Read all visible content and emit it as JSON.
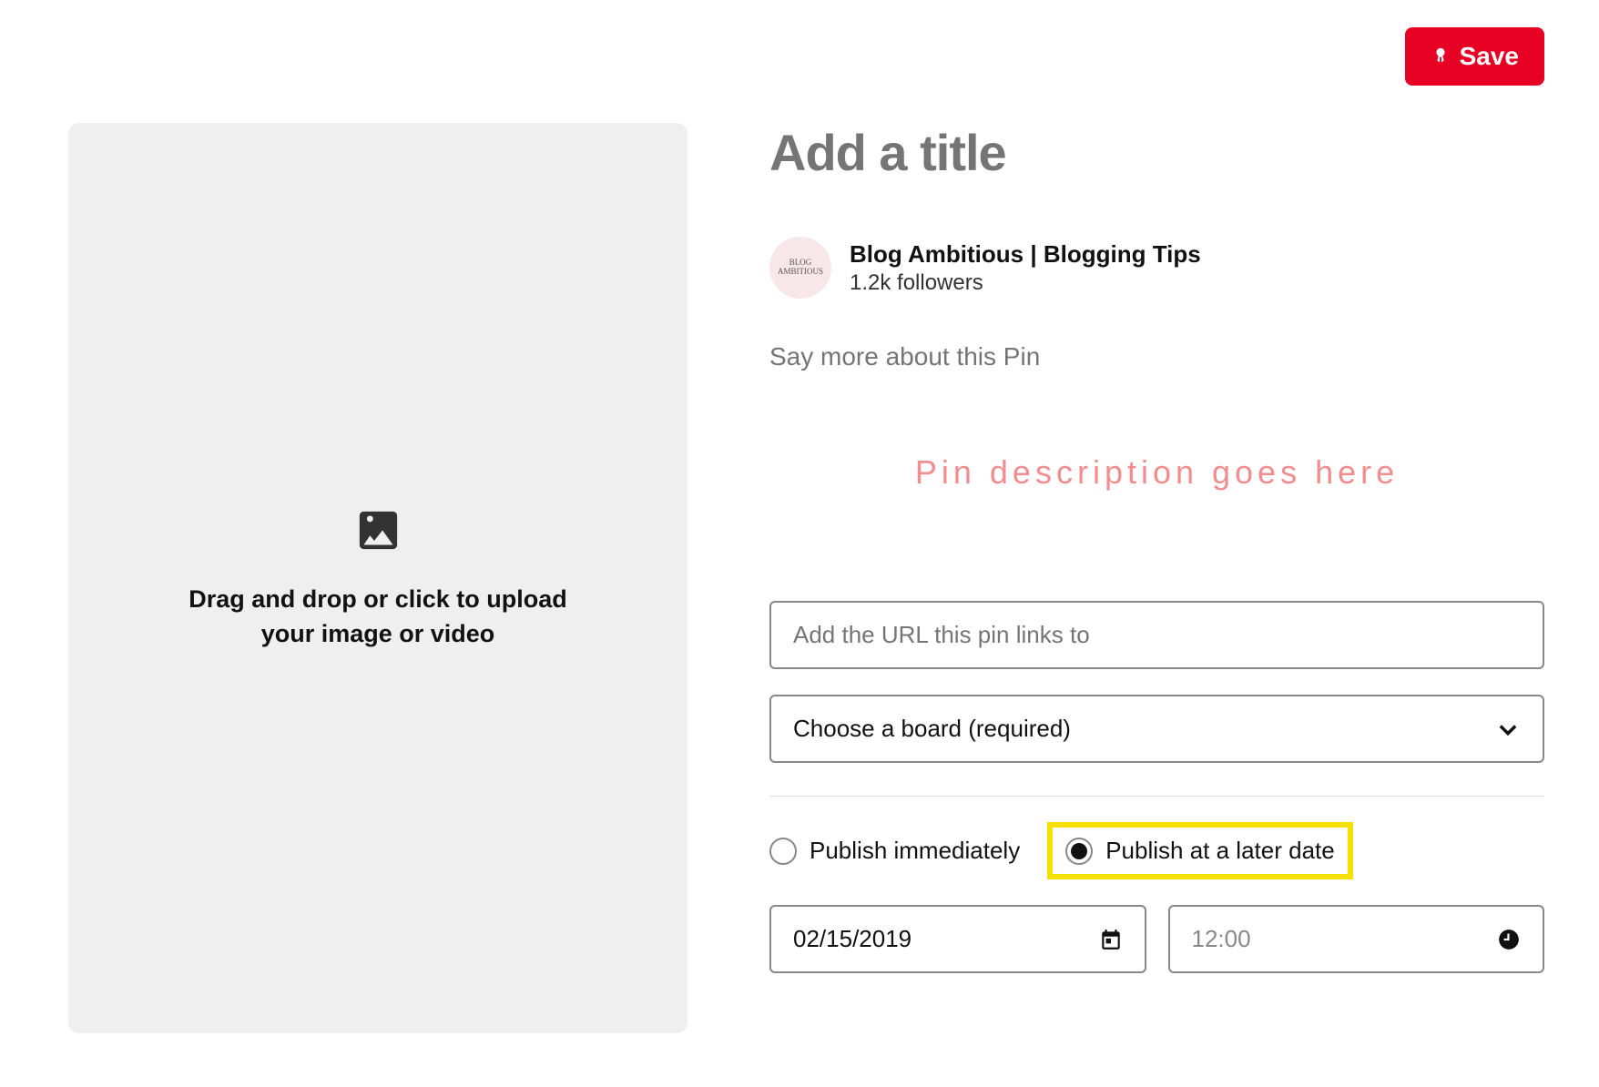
{
  "save_button": {
    "label": "Save"
  },
  "dropzone": {
    "text": "Drag and drop or click to upload your image or video"
  },
  "title": {
    "placeholder": "Add a title"
  },
  "author": {
    "name": "Blog Ambitious | Blogging Tips",
    "followers": "1.2k followers",
    "avatar_text": "BLOG AMBITIOUS"
  },
  "description": {
    "placeholder": "Say more about this Pin"
  },
  "annotation": {
    "text": "Pin description goes here"
  },
  "url": {
    "placeholder": "Add the URL this pin links to"
  },
  "board": {
    "placeholder": "Choose a board (required)"
  },
  "publish": {
    "immediate": {
      "label": "Publish immediately",
      "selected": false
    },
    "later": {
      "label": "Publish at a later date",
      "selected": true
    }
  },
  "date": {
    "value": "02/15/2019"
  },
  "time": {
    "value": "12:00"
  }
}
